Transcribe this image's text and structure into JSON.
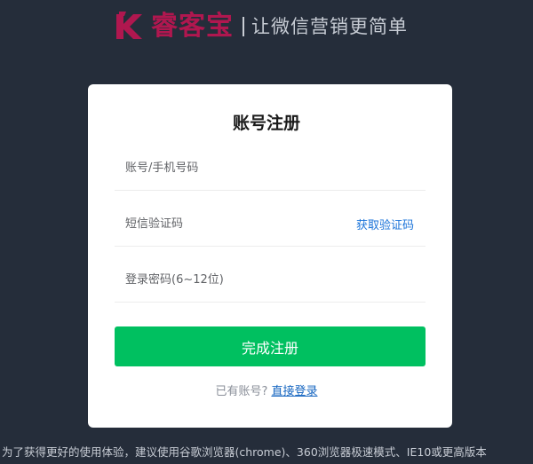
{
  "header": {
    "brand": "睿客宝",
    "slogan": "让微信营销更简单",
    "brand_color": "#b0174f"
  },
  "form": {
    "title": "账号注册",
    "account_placeholder": "账号/手机号码",
    "code_placeholder": "短信验证码",
    "get_code_label": "获取验证码",
    "password_placeholder": "登录密码(6~12位)",
    "submit_label": "完成注册",
    "has_account_text": "已有账号?",
    "login_link_label": "直接登录"
  },
  "footer": {
    "note": "为了获得更好的使用体验，建议使用谷歌浏览器(chrome)、360浏览器极速模式、IE10或更高版本"
  },
  "colors": {
    "background": "#252d3a",
    "card": "#ffffff",
    "primary_button": "#00c060",
    "link": "#1565c0"
  }
}
